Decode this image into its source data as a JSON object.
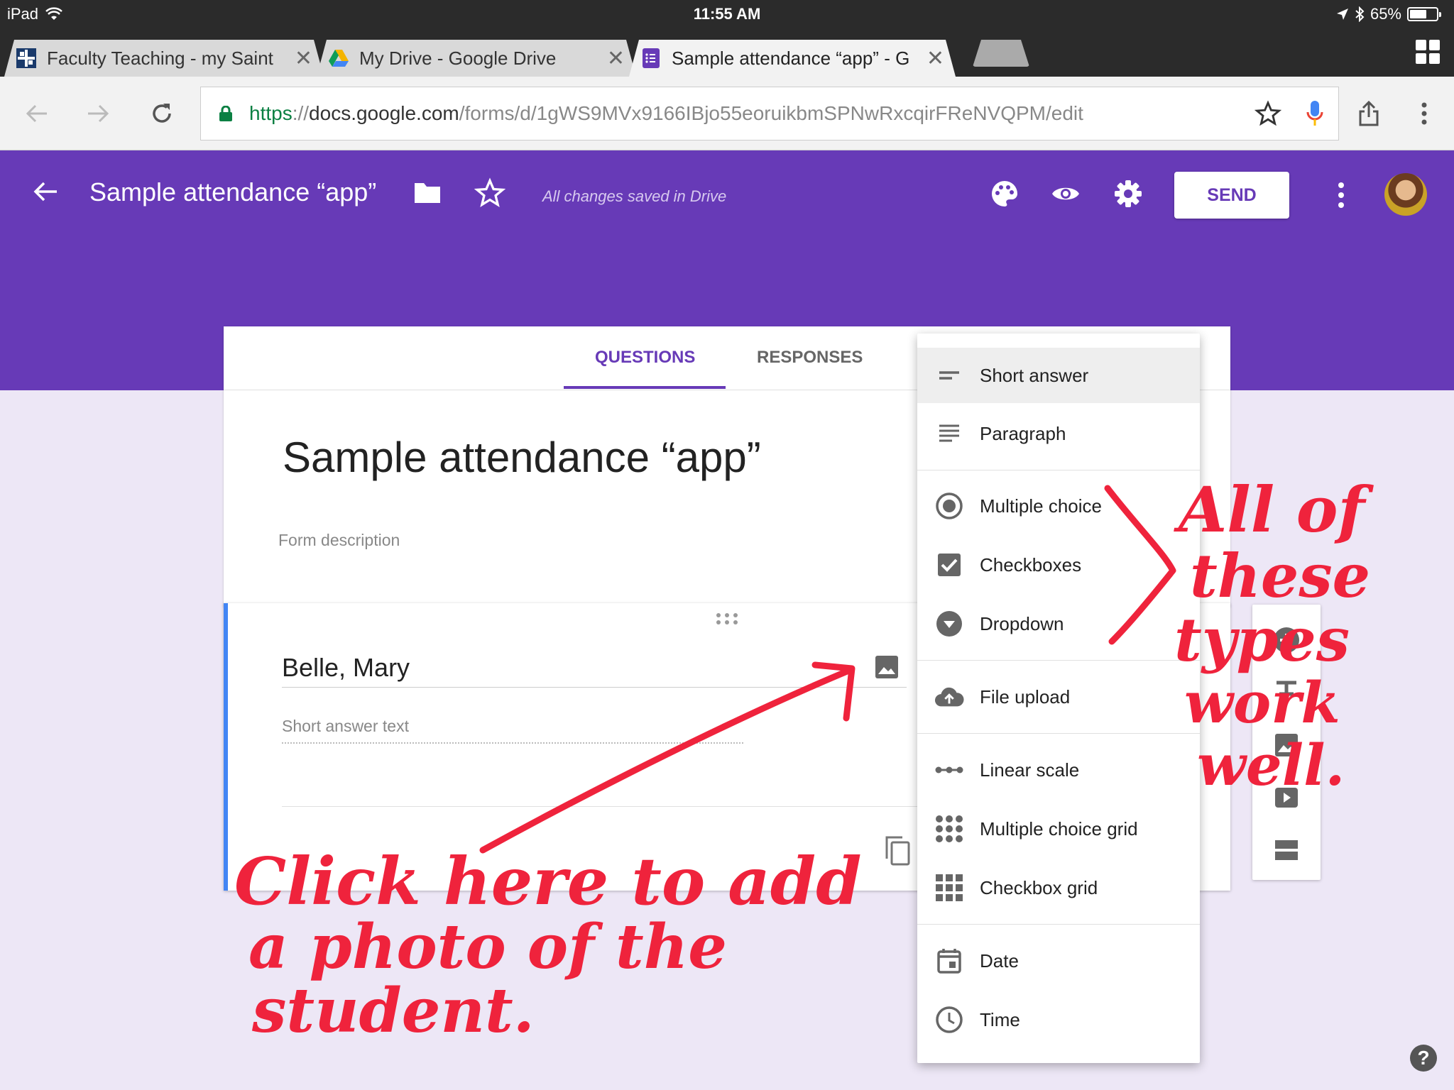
{
  "status_bar": {
    "device": "iPad",
    "time": "11:55 AM",
    "battery": "65%",
    "battery_level": 0.65
  },
  "browser": {
    "tabs": [
      {
        "title": "Faculty Teaching - my Saint",
        "icon": "saint-favicon",
        "active": false
      },
      {
        "title": "My Drive - Google Drive",
        "icon": "google-drive-icon",
        "active": false
      },
      {
        "title": "Sample attendance “app” - G",
        "icon": "google-forms-icon",
        "active": true
      }
    ],
    "url": {
      "scheme": "https",
      "separator": "://",
      "host": "docs.google.com",
      "path": "/forms/d/1gWS9MVx9166IBjo55eoruikbmSPNwRxcqirFReNVQPM/edit"
    }
  },
  "forms_header": {
    "title": "Sample attendance “app”",
    "save_status": "All changes saved in Drive",
    "send_label": "SEND",
    "brand_color": "#673ab7"
  },
  "form": {
    "tabs": [
      "QUESTIONS",
      "RESPONSES"
    ],
    "active_tab": "QUESTIONS",
    "title": "Sample attendance “app”",
    "description_placeholder": "Form description",
    "question": {
      "title": "Belle, Mary",
      "answer_placeholder": "Short answer text"
    }
  },
  "type_menu": {
    "items": [
      {
        "label": "Short answer",
        "icon": "short-answer-icon",
        "selected": true
      },
      {
        "label": "Paragraph",
        "icon": "paragraph-icon"
      },
      {
        "label": "Multiple choice",
        "icon": "radio-icon"
      },
      {
        "label": "Checkboxes",
        "icon": "checkbox-icon"
      },
      {
        "label": "Dropdown",
        "icon": "dropdown-icon"
      },
      {
        "label": "File upload",
        "icon": "cloud-upload-icon"
      },
      {
        "label": "Linear scale",
        "icon": "linear-scale-icon"
      },
      {
        "label": "Multiple choice grid",
        "icon": "mc-grid-icon"
      },
      {
        "label": "Checkbox grid",
        "icon": "checkbox-grid-icon"
      },
      {
        "label": "Date",
        "icon": "calendar-icon"
      },
      {
        "label": "Time",
        "icon": "clock-icon"
      }
    ]
  },
  "annotations": {
    "photo_note": [
      "Click here to add",
      "a photo of the",
      "student."
    ],
    "types_note": [
      "All of",
      "these",
      "types",
      "work",
      "well."
    ],
    "ink_color": "#ef233c"
  }
}
